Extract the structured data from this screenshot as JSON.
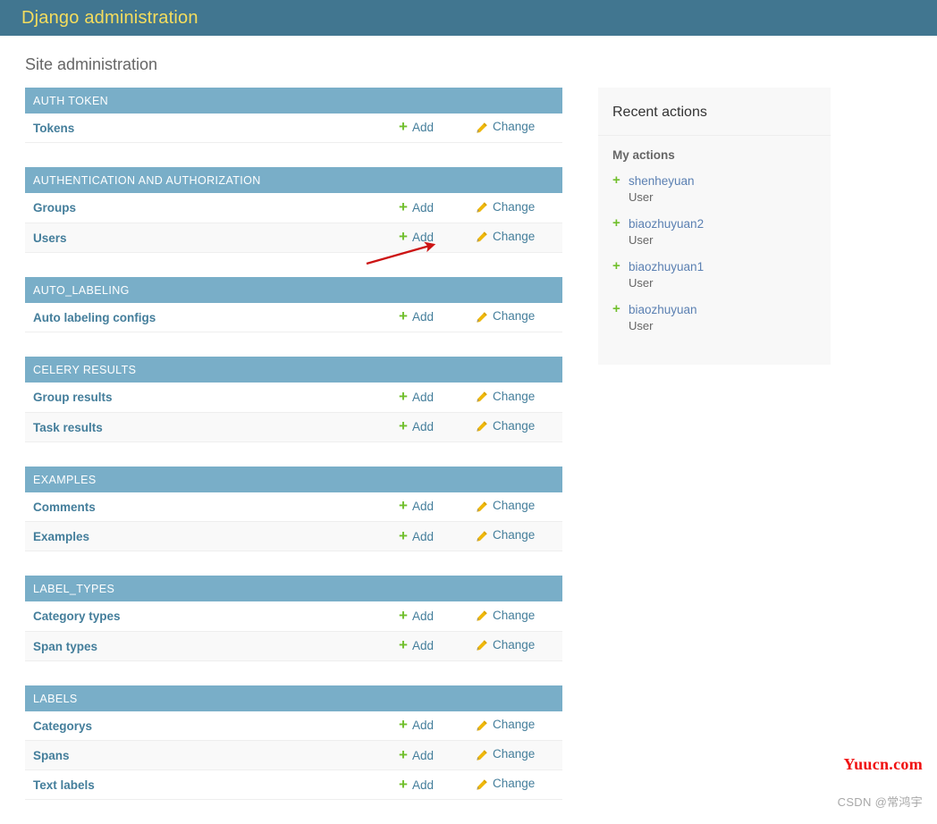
{
  "header": {
    "branding_title": "Django administration"
  },
  "page": {
    "title": "Site administration"
  },
  "labels": {
    "add": "Add",
    "change": "Change",
    "plus_icon": "plus-icon",
    "pencil_icon": "pencil-icon"
  },
  "app_list": [
    {
      "caption": "AUTH TOKEN",
      "models": [
        {
          "name": "Tokens",
          "add": "Add",
          "change": "Change"
        }
      ]
    },
    {
      "caption": "AUTHENTICATION AND AUTHORIZATION",
      "models": [
        {
          "name": "Groups",
          "add": "Add",
          "change": "Change"
        },
        {
          "name": "Users",
          "add": "Add",
          "change": "Change"
        }
      ]
    },
    {
      "caption": "AUTO_LABELING",
      "models": [
        {
          "name": "Auto labeling configs",
          "add": "Add",
          "change": "Change"
        }
      ]
    },
    {
      "caption": "CELERY RESULTS",
      "models": [
        {
          "name": "Group results",
          "add": "Add",
          "change": "Change"
        },
        {
          "name": "Task results",
          "add": "Add",
          "change": "Change"
        }
      ]
    },
    {
      "caption": "EXAMPLES",
      "models": [
        {
          "name": "Comments",
          "add": "Add",
          "change": "Change"
        },
        {
          "name": "Examples",
          "add": "Add",
          "change": "Change"
        }
      ]
    },
    {
      "caption": "LABEL_TYPES",
      "models": [
        {
          "name": "Category types",
          "add": "Add",
          "change": "Change"
        },
        {
          "name": "Span types",
          "add": "Add",
          "change": "Change"
        }
      ]
    },
    {
      "caption": "LABELS",
      "models": [
        {
          "name": "Categorys",
          "add": "Add",
          "change": "Change"
        },
        {
          "name": "Spans",
          "add": "Add",
          "change": "Change"
        },
        {
          "name": "Text labels",
          "add": "Add",
          "change": "Change"
        }
      ]
    }
  ],
  "recent_actions": {
    "title": "Recent actions",
    "subtitle": "My actions",
    "items": [
      {
        "name": "shenheyuan",
        "model": "User",
        "icon": "plus-icon"
      },
      {
        "name": "biaozhuyuan2",
        "model": "User",
        "icon": "plus-icon"
      },
      {
        "name": "biaozhuyuan1",
        "model": "User",
        "icon": "plus-icon"
      },
      {
        "name": "biaozhuyuan",
        "model": "User",
        "icon": "plus-icon"
      }
    ]
  },
  "annotation": {
    "arrow_color": "#cc1414",
    "points_to": "Users row Add link"
  },
  "watermark": {
    "brand": "Yuucn.com",
    "credit": "CSDN @常鸿宇"
  },
  "colors": {
    "header_bg": "#417690",
    "header_title": "#f5dd5d",
    "module_caption_bg": "#79aec8",
    "link": "#447e9b",
    "add_plus": "#70bf2b",
    "pencil": "#efb80b",
    "recent_link": "#5b80b2",
    "watermark_brand": "#f01010"
  }
}
